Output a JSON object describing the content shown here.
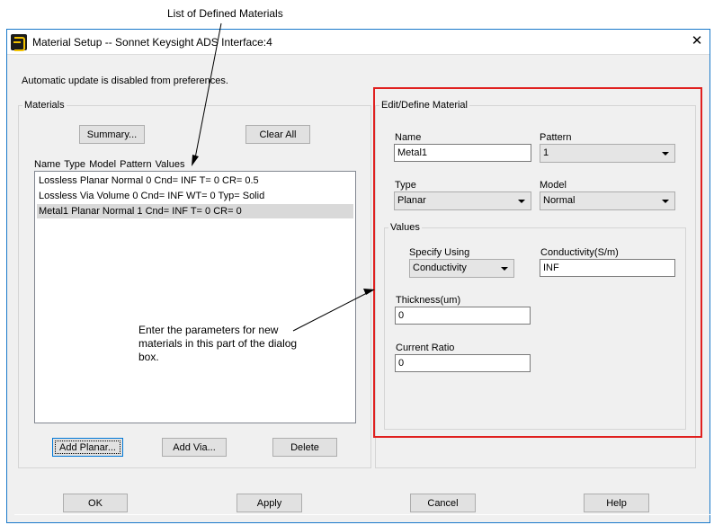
{
  "annotations": {
    "top": "List of Defined Materials",
    "middle": "Enter the parameters for new materials in this part of the dialog box."
  },
  "window": {
    "title": "Material Setup -- Sonnet Keysight ADS Interface:4",
    "close_icon": "close-icon",
    "app_icon": "sonnet-app-icon"
  },
  "notice": "Automatic update is disabled from preferences.",
  "materials": {
    "legend": "Materials",
    "summary_button": "Summary...",
    "clear_all_button": "Clear All",
    "list_header": "Name  Type  Model  Pattern  Values",
    "items": [
      "Lossless  Planar  Normal  0  Cnd= INF T= 0 CR= 0.5",
      "Lossless  Via  Volume  0  Cnd= INF WT= 0 Typ= Solid",
      "Metal1  Planar  Normal  1  Cnd= INF T= 0 CR= 0"
    ],
    "selected_index": 2,
    "add_planar_button": "Add Planar...",
    "add_via_button": "Add Via...",
    "delete_button": "Delete"
  },
  "edit": {
    "legend": "Edit/Define Material",
    "name_label": "Name",
    "name_value": "Metal1",
    "pattern_label": "Pattern",
    "pattern_value": "1",
    "type_label": "Type",
    "type_value": "Planar",
    "model_label": "Model",
    "model_value": "Normal",
    "values": {
      "legend": "Values",
      "specify_label": "Specify Using",
      "specify_value": "Conductivity",
      "conductivity_label": "Conductivity(S/m)",
      "conductivity_value": "INF",
      "thickness_label": "Thickness(um)",
      "thickness_value": "0",
      "current_ratio_label": "Current Ratio",
      "current_ratio_value": "0"
    }
  },
  "footer": {
    "ok": "OK",
    "apply": "Apply",
    "cancel": "Cancel",
    "help": "Help"
  },
  "colors": {
    "highlight_box": "#e0201f",
    "window_border": "#1979ca",
    "dialog_bg": "#f0f0f0"
  }
}
